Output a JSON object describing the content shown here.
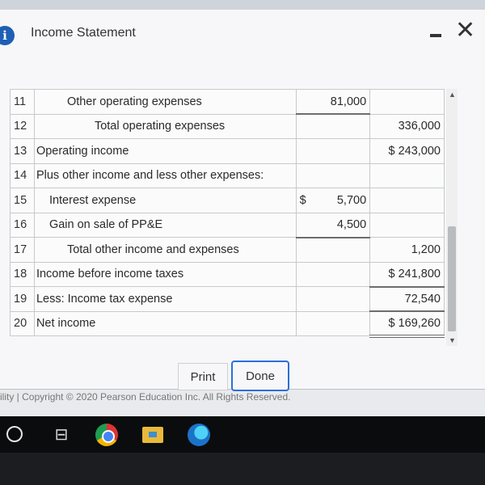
{
  "window": {
    "title": "Income Statement"
  },
  "rows": [
    {
      "n": "11",
      "label": "Other operating expenses",
      "indent": 2,
      "c1": "81,000",
      "c2": ""
    },
    {
      "n": "12",
      "label": "Total operating expenses",
      "indent": 3,
      "c1": "",
      "c2": "336,000"
    },
    {
      "n": "13",
      "label": "Operating income",
      "indent": 0,
      "c1": "",
      "c2": "$  243,000"
    },
    {
      "n": "14",
      "label": "Plus other income and less other expenses:",
      "indent": 0,
      "c1": "",
      "c2": ""
    },
    {
      "n": "15",
      "label": "Interest expense",
      "indent": 1,
      "c1": "5,700",
      "c1sign": "$",
      "c2": ""
    },
    {
      "n": "16",
      "label": "Gain on sale of PP&E",
      "indent": 1,
      "c1": "4,500",
      "c2": ""
    },
    {
      "n": "17",
      "label": "Total other income and expenses",
      "indent": 2,
      "c1": "",
      "c2": "1,200"
    },
    {
      "n": "18",
      "label": "Income before income taxes",
      "indent": 0,
      "c1": "",
      "c2": "$  241,800"
    },
    {
      "n": "19",
      "label": "Less: Income tax expense",
      "indent": 0,
      "c1": "",
      "c2": "72,540"
    },
    {
      "n": "20",
      "label": "Net income",
      "indent": 0,
      "c1": "",
      "c2": "$  169,260"
    }
  ],
  "buttons": {
    "print": "Print",
    "done": "Done"
  },
  "footer": {
    "copyright": "ility | Copyright © 2020 Pearson Education Inc. All Rights Reserved."
  },
  "colors": {
    "accent": "#2a6fdb",
    "info": "#1f5fb4"
  }
}
